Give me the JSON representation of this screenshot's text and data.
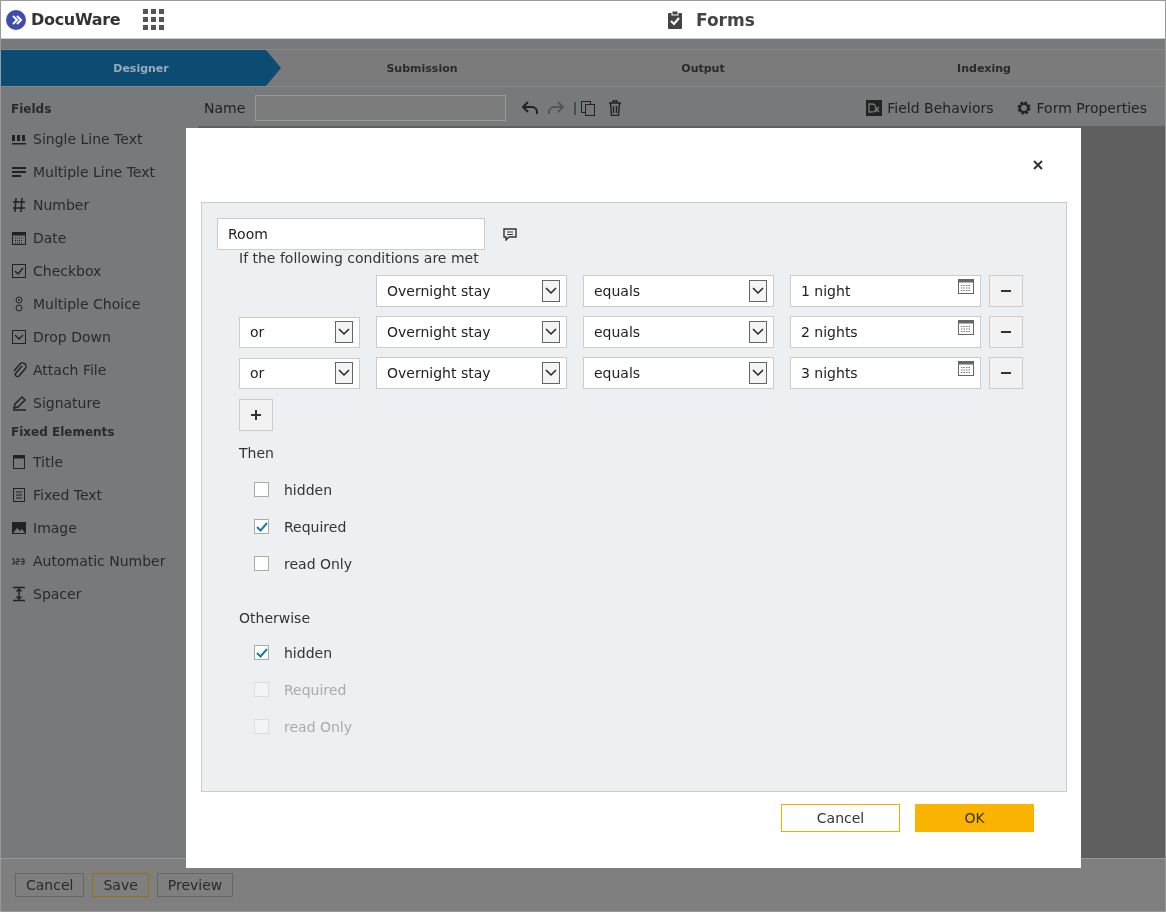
{
  "header": {
    "logo_text": "DocuWare",
    "title": "Forms"
  },
  "steps": [
    {
      "label": "Designer",
      "selected": true
    },
    {
      "label": "Submission",
      "selected": false
    },
    {
      "label": "Output",
      "selected": false
    },
    {
      "label": "Indexing",
      "selected": false
    }
  ],
  "sidebar": [
    {
      "heading": "Fields",
      "items": [
        "Single Line Text",
        "Multiple Line Text",
        "Number",
        "Date",
        "Checkbox",
        "Multiple Choice",
        "Drop Down",
        "Attach File",
        "Signature"
      ]
    },
    {
      "heading": "Fixed Elements",
      "items": [
        "Title",
        "Fixed Text",
        "Image",
        "Automatic Number",
        "Spacer"
      ]
    }
  ],
  "toolbar": {
    "name_label": "Name",
    "field_behaviors": "Field Behaviors",
    "form_properties": "Form Properties"
  },
  "dialog": {
    "field": "Room",
    "conditions_label": "If the following conditions are met",
    "conditions": [
      {
        "field": "Overnight stay",
        "operator": "equals",
        "value": "1 night"
      },
      {
        "connector": "or",
        "field": "Overnight stay",
        "operator": "equals",
        "value": "2 nights"
      },
      {
        "connector": "or",
        "field": "Overnight stay",
        "operator": "equals",
        "value": "3 nights"
      }
    ],
    "then_label": "Then",
    "then_options": [
      {
        "label": "hidden",
        "checked": false,
        "disabled": false
      },
      {
        "label": "Required",
        "checked": true,
        "disabled": false
      },
      {
        "label": "read Only",
        "checked": false,
        "disabled": false
      }
    ],
    "otherwise_label": "Otherwise",
    "otherwise_options": [
      {
        "label": "hidden",
        "checked": true,
        "disabled": false
      },
      {
        "label": "Required",
        "checked": false,
        "disabled": true
      },
      {
        "label": "read Only",
        "checked": false,
        "disabled": true
      }
    ],
    "cancel": "Cancel",
    "ok": "OK"
  },
  "footer": [
    {
      "label": "Cancel",
      "kind": "plain"
    },
    {
      "label": "Save",
      "kind": "primary"
    },
    {
      "label": "Preview",
      "kind": "plain"
    }
  ]
}
